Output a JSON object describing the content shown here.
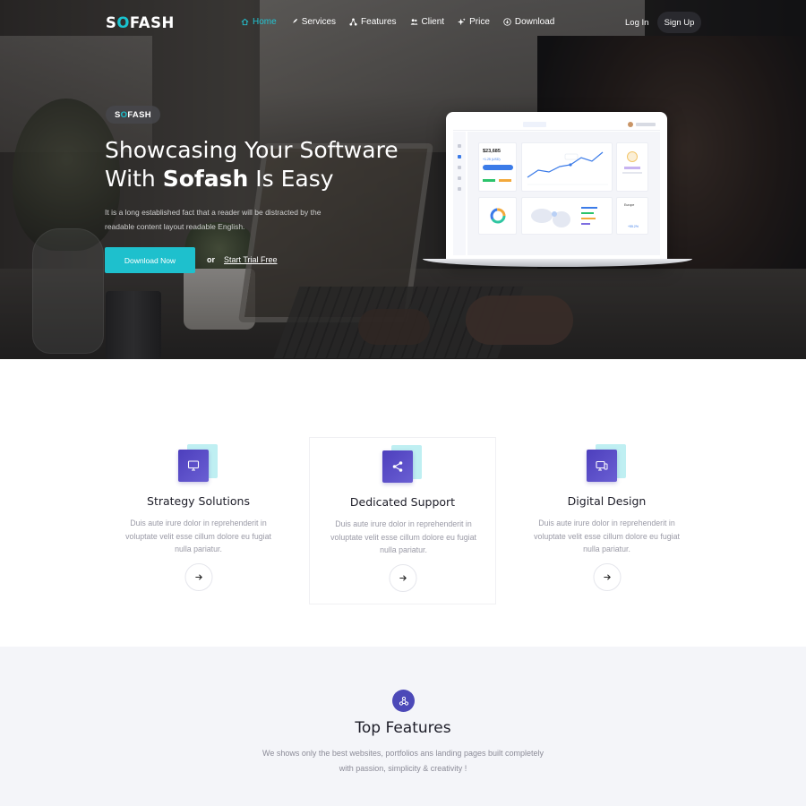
{
  "brand": {
    "prefix": "S",
    "o": "O",
    "suffix": "FASH"
  },
  "nav": {
    "items": [
      {
        "label": "Home",
        "icon": "home-icon",
        "active": true
      },
      {
        "label": "Services",
        "icon": "rocket-icon"
      },
      {
        "label": "Features",
        "icon": "network-icon"
      },
      {
        "label": "Client",
        "icon": "users-icon"
      },
      {
        "label": "Price",
        "icon": "sparkle-icon"
      },
      {
        "label": "Download",
        "icon": "download-icon"
      }
    ],
    "login": "Log In",
    "signup": "Sign Up"
  },
  "hero": {
    "badge_prefix": "S",
    "badge_o": "O",
    "badge_suffix": "FASH",
    "title_line1": "Showcasing Your Software",
    "title_with": "With",
    "title_brand": "Sofash",
    "title_end": "Is Easy",
    "lead": "It is a long established fact that a reader will be distracted by the readable content layout readable English.",
    "cta_primary": "Download Now",
    "or": "or",
    "cta_secondary": "Start Trial Free"
  },
  "dashboard": {
    "balance": "$23,685",
    "delta": "+1.25 (USD)",
    "region_label": "Europe",
    "region_value": "+55.2%"
  },
  "services": [
    {
      "title": "Strategy Solutions",
      "icon": "monitor-icon",
      "desc": "Duis aute irure dolor in reprehenderit in voluptate velit esse cillum dolore eu fugiat nulla pariatur."
    },
    {
      "title": "Dedicated Support",
      "icon": "share-icon",
      "desc": "Duis aute irure dolor in reprehenderit in voluptate velit esse cillum dolore eu fugiat nulla pariatur."
    },
    {
      "title": "Digital Design",
      "icon": "devices-icon",
      "desc": "Duis aute irure dolor in reprehenderit in voluptate velit esse cillum dolore eu fugiat nulla pariatur."
    }
  ],
  "features": {
    "icon": "nodes-icon",
    "title": "Top Features",
    "subtitle": "We shows only the best websites, portfolios ans landing pages built completely with passion, simplicity & creativity !"
  },
  "colors": {
    "accent": "#1ec0cd",
    "primary": "#4c49b8",
    "text_dark": "#1d1d28",
    "text_muted": "#9a9aa6"
  }
}
